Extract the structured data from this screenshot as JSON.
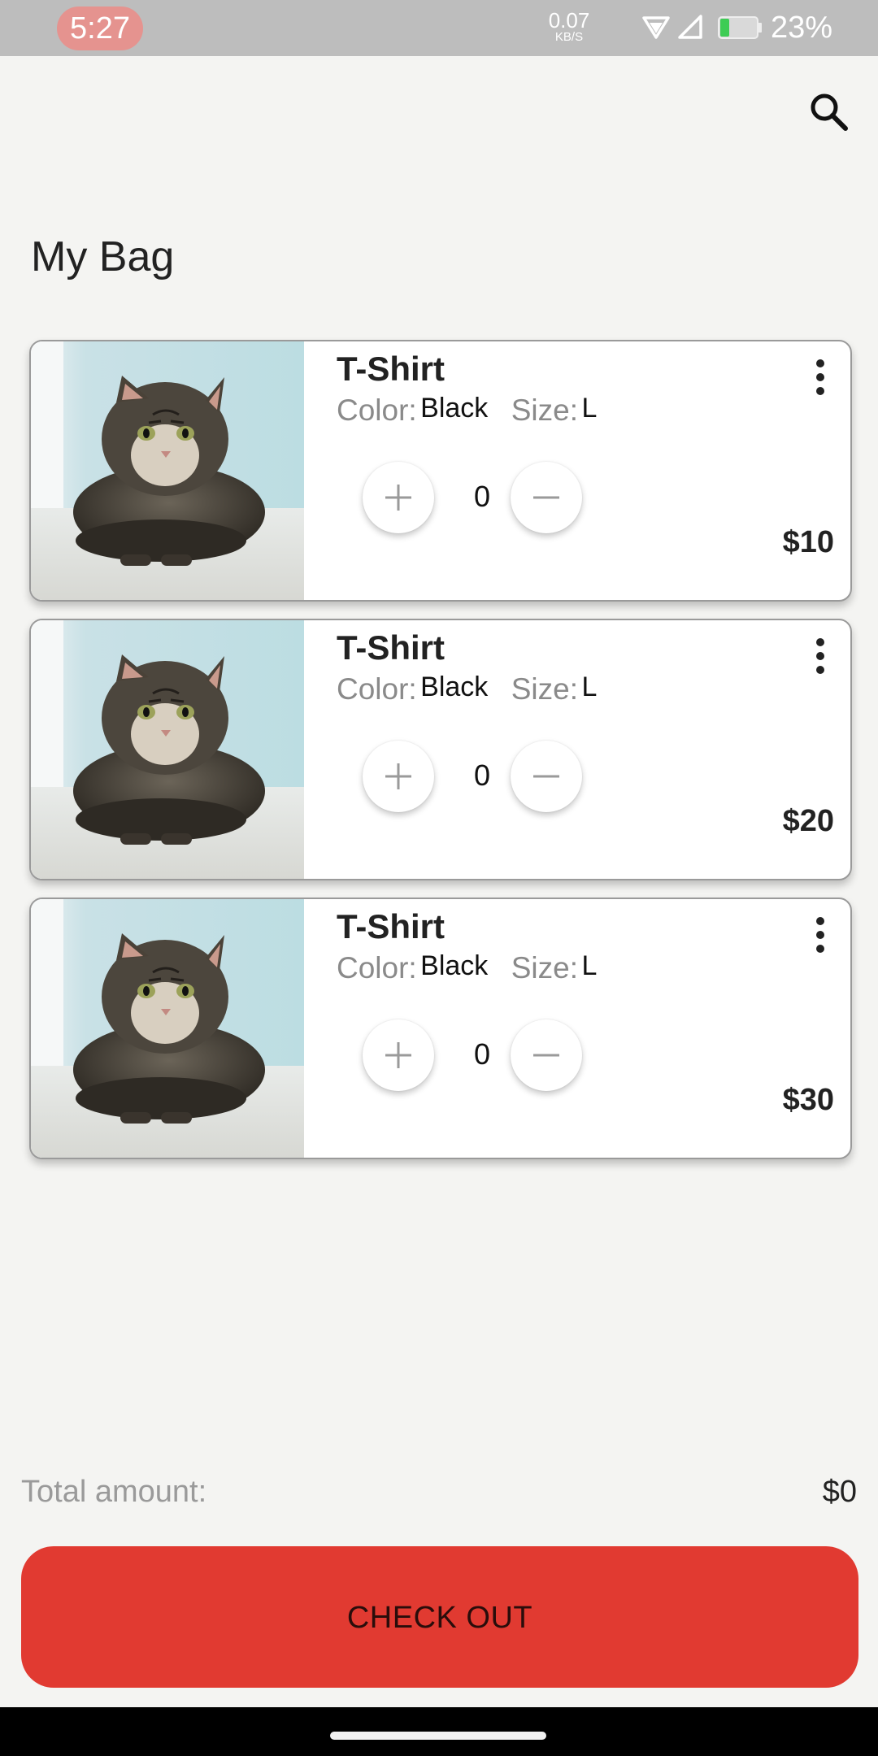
{
  "status_bar": {
    "time": "5:27",
    "net_speed_value": "0.07",
    "net_speed_unit": "KB/S",
    "battery_percent": "23%",
    "battery_level": 0.23,
    "icons": [
      "wifi-icon",
      "signal-icon",
      "battery-icon"
    ]
  },
  "header": {
    "title": "My Bag",
    "search_icon": "search-icon"
  },
  "products": [
    {
      "name": "T-Shirt",
      "color_label": "Color:",
      "color": "Black",
      "size_label": "Size:",
      "size": "L",
      "quantity": "0",
      "price": "$10",
      "image": "cat-photo"
    },
    {
      "name": "T-Shirt",
      "color_label": "Color:",
      "color": "Black",
      "size_label": "Size:",
      "size": "L",
      "quantity": "0",
      "price": "$20",
      "image": "cat-photo"
    },
    {
      "name": "T-Shirt",
      "color_label": "Color:",
      "color": "Black",
      "size_label": "Size:",
      "size": "L",
      "quantity": "0",
      "price": "$30",
      "image": "cat-photo"
    }
  ],
  "footer": {
    "total_label": "Total amount:",
    "total_value": "$0",
    "checkout_label": "CHECK OUT"
  },
  "colors": {
    "accent": "#e13a31",
    "background": "#f4f4f2",
    "status_bar": "#bdbdbd"
  }
}
